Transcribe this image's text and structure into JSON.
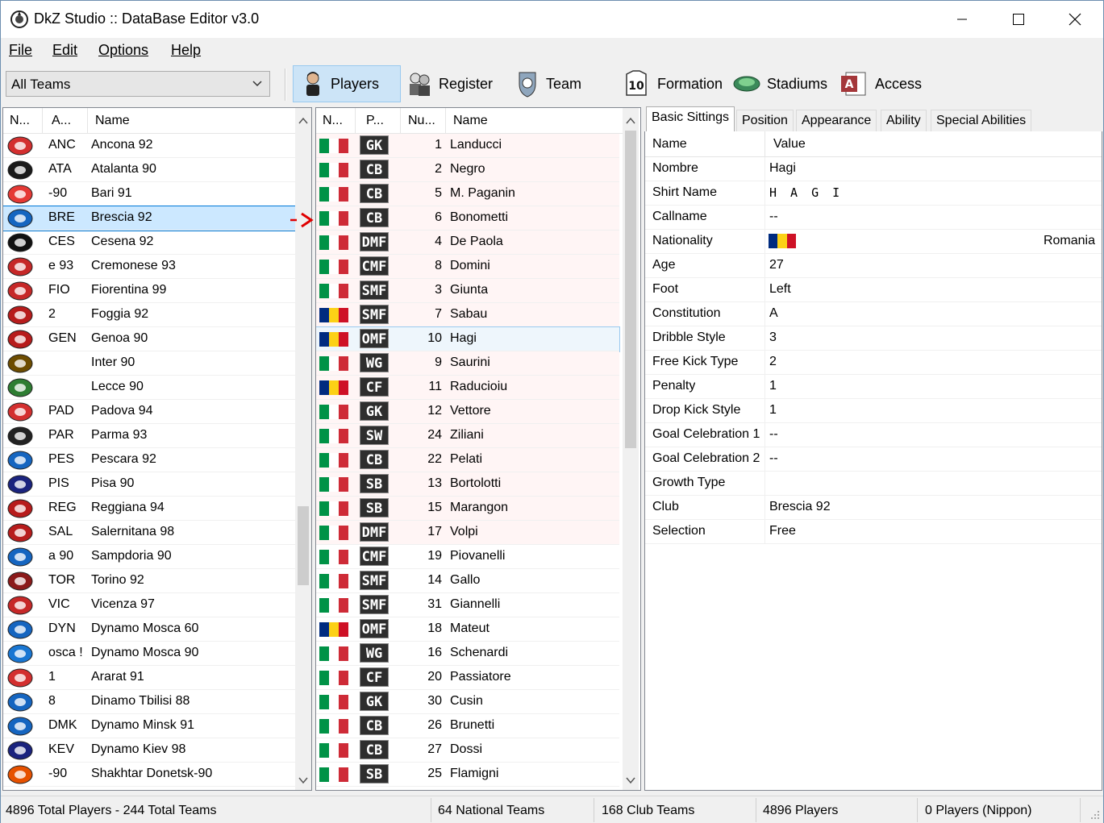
{
  "window": {
    "title": "DkZ Studio :: DataBase Editor v3.0"
  },
  "menu": [
    {
      "label": "File"
    },
    {
      "label": "Edit"
    },
    {
      "label": "Options"
    },
    {
      "label": "Help"
    }
  ],
  "toolbar": {
    "team_filter": "All Teams",
    "buttons": [
      {
        "label": "Players",
        "icon": "player-icon",
        "active": true
      },
      {
        "label": "Register",
        "icon": "register-icon"
      },
      {
        "label": "Team",
        "icon": "team-icon"
      },
      {
        "label": "Formation",
        "icon": "formation-icon"
      },
      {
        "label": "Stadiums",
        "icon": "stadium-icon"
      },
      {
        "label": "Access",
        "icon": "access-icon"
      }
    ]
  },
  "teams": {
    "headers": [
      "N...",
      "A...",
      "Name"
    ],
    "selected_index": 3,
    "rows": [
      {
        "abbr": "ANC",
        "name": "Ancona 92",
        "color": "#d32f2f"
      },
      {
        "abbr": "ATA",
        "name": "Atalanta 90",
        "color": "#1a1a1a"
      },
      {
        "abbr": "-90",
        "name": "Bari 91",
        "color": "#e53935"
      },
      {
        "abbr": "BRE",
        "name": "Brescia 92",
        "color": "#1565c0"
      },
      {
        "abbr": "CES",
        "name": "Cesena 92",
        "color": "#111111"
      },
      {
        "abbr": "e 93",
        "name": "Cremonese 93",
        "color": "#c62828"
      },
      {
        "abbr": "FIO",
        "name": "Fiorentina 99",
        "color": "#c62828"
      },
      {
        "abbr": "2",
        "name": "Foggia 92",
        "color": "#b71c1c"
      },
      {
        "abbr": "GEN",
        "name": "Genoa 90",
        "color": "#b71c1c"
      },
      {
        "abbr": "",
        "name": "Inter 90",
        "color": "#6d4c00"
      },
      {
        "abbr": "",
        "name": "Lecce 90",
        "color": "#2e7d32"
      },
      {
        "abbr": "PAD",
        "name": "Padova 94",
        "color": "#d32f2f"
      },
      {
        "abbr": "PAR",
        "name": "Parma 93",
        "color": "#222222"
      },
      {
        "abbr": "PES",
        "name": "Pescara 92",
        "color": "#1565c0"
      },
      {
        "abbr": "PIS",
        "name": "Pisa 90",
        "color": "#1a237e"
      },
      {
        "abbr": "REG",
        "name": "Reggiana 94",
        "color": "#b71c1c"
      },
      {
        "abbr": "SAL",
        "name": "Salernitana 98",
        "color": "#b71c1c"
      },
      {
        "abbr": "a 90",
        "name": "Sampdoria 90",
        "color": "#1565c0"
      },
      {
        "abbr": "TOR",
        "name": "Torino 92",
        "color": "#8b1a1a"
      },
      {
        "abbr": "VIC",
        "name": "Vicenza 97",
        "color": "#c62828"
      },
      {
        "abbr": "DYN",
        "name": "Dynamo Mosca 60",
        "color": "#1565c0"
      },
      {
        "abbr": "osca !",
        "name": "Dynamo Mosca 90",
        "color": "#1976d2"
      },
      {
        "abbr": "1",
        "name": "Ararat 91",
        "color": "#d32f2f"
      },
      {
        "abbr": "8",
        "name": "Dinamo Tbilisi 88",
        "color": "#1565c0"
      },
      {
        "abbr": "DMK",
        "name": "Dynamo Minsk 91",
        "color": "#1565c0"
      },
      {
        "abbr": "KEV",
        "name": "Dynamo Kiev 98",
        "color": "#1a237e"
      },
      {
        "abbr": "-90",
        "name": "Shakhtar Donetsk-90",
        "color": "#e65100"
      }
    ]
  },
  "players": {
    "headers": [
      "N...",
      "P...",
      "Nu...",
      "Name"
    ],
    "selected_index": 8,
    "flags": {
      "italy": [
        "#009246",
        "#ffffff",
        "#ce2b37"
      ],
      "romania": [
        "#002b7f",
        "#fcd116",
        "#ce1126"
      ]
    },
    "rows": [
      {
        "flag": "italy",
        "pos": "GK",
        "num": "1",
        "name": "Landucci"
      },
      {
        "flag": "italy",
        "pos": "CB",
        "num": "2",
        "name": "Negro"
      },
      {
        "flag": "italy",
        "pos": "CB",
        "num": "5",
        "name": "M. Paganin"
      },
      {
        "flag": "italy",
        "pos": "CB",
        "num": "6",
        "name": "Bonometti"
      },
      {
        "flag": "italy",
        "pos": "DMF",
        "num": "4",
        "name": "De Paola"
      },
      {
        "flag": "italy",
        "pos": "CMF",
        "num": "8",
        "name": "Domini"
      },
      {
        "flag": "italy",
        "pos": "SMF",
        "num": "3",
        "name": "Giunta"
      },
      {
        "flag": "romania",
        "pos": "SMF",
        "num": "7",
        "name": "Sabau"
      },
      {
        "flag": "romania",
        "pos": "OMF",
        "num": "10",
        "name": "Hagi"
      },
      {
        "flag": "italy",
        "pos": "WG",
        "num": "9",
        "name": "Saurini"
      },
      {
        "flag": "romania",
        "pos": "CF",
        "num": "11",
        "name": "Raducioiu"
      },
      {
        "flag": "italy",
        "pos": "GK",
        "num": "12",
        "name": "Vettore"
      },
      {
        "flag": "italy",
        "pos": "SW",
        "num": "24",
        "name": "Ziliani"
      },
      {
        "flag": "italy",
        "pos": "CB",
        "num": "22",
        "name": "Pelati"
      },
      {
        "flag": "italy",
        "pos": "SB",
        "num": "13",
        "name": "Bortolotti"
      },
      {
        "flag": "italy",
        "pos": "SB",
        "num": "15",
        "name": "Marangon"
      },
      {
        "flag": "italy",
        "pos": "DMF",
        "num": "17",
        "name": "Volpi"
      },
      {
        "flag": "italy",
        "pos": "CMF",
        "num": "19",
        "name": "Piovanelli"
      },
      {
        "flag": "italy",
        "pos": "SMF",
        "num": "14",
        "name": "Gallo"
      },
      {
        "flag": "italy",
        "pos": "SMF",
        "num": "31",
        "name": "Giannelli"
      },
      {
        "flag": "romania",
        "pos": "OMF",
        "num": "18",
        "name": "Mateut"
      },
      {
        "flag": "italy",
        "pos": "WG",
        "num": "16",
        "name": "Schenardi"
      },
      {
        "flag": "italy",
        "pos": "CF",
        "num": "20",
        "name": "Passiatore"
      },
      {
        "flag": "italy",
        "pos": "GK",
        "num": "30",
        "name": "Cusin"
      },
      {
        "flag": "italy",
        "pos": "CB",
        "num": "26",
        "name": "Brunetti"
      },
      {
        "flag": "italy",
        "pos": "CB",
        "num": "27",
        "name": "Dossi"
      },
      {
        "flag": "italy",
        "pos": "SB",
        "num": "25",
        "name": "Flamigni"
      }
    ]
  },
  "details": {
    "tabs": [
      "Basic Sittings",
      "Position",
      "Appearance",
      "Ability",
      "Special Abilities"
    ],
    "active_tab": 0,
    "headers": [
      "Name",
      "Value"
    ],
    "rows": [
      {
        "label": "Nombre",
        "value": "Hagi"
      },
      {
        "label": "Shirt Name",
        "value": "H A G I"
      },
      {
        "label": "Callname",
        "value": "--"
      },
      {
        "label": "Nationality",
        "value": "",
        "flag": "romania",
        "extra": "Romania"
      },
      {
        "label": "Age",
        "value": "27"
      },
      {
        "label": "Foot",
        "value": "Left"
      },
      {
        "label": "Constitution",
        "value": "A"
      },
      {
        "label": "Dribble Style",
        "value": "3"
      },
      {
        "label": "Free Kick Type",
        "value": "2"
      },
      {
        "label": "Penalty",
        "value": "1"
      },
      {
        "label": "Drop Kick Style",
        "value": "1"
      },
      {
        "label": "Goal Celebration 1",
        "value": "--"
      },
      {
        "label": "Goal Celebration 2",
        "value": "--"
      },
      {
        "label": "Growth Type",
        "value": ""
      },
      {
        "label": "Club",
        "value": "Brescia 92"
      },
      {
        "label": "Selection",
        "value": "Free"
      }
    ]
  },
  "status": {
    "totals": "4896 Total Players  -  244 Total Teams",
    "national": "64 National Teams",
    "club": "168 Club Teams",
    "players": "4896 Players",
    "nippon": "0 Players (Nippon)"
  },
  "colors": {
    "selection": "#cce8ff",
    "selection_border": "#0078d7",
    "arrow": "#e00000",
    "row_tint": "#fff5f5"
  }
}
